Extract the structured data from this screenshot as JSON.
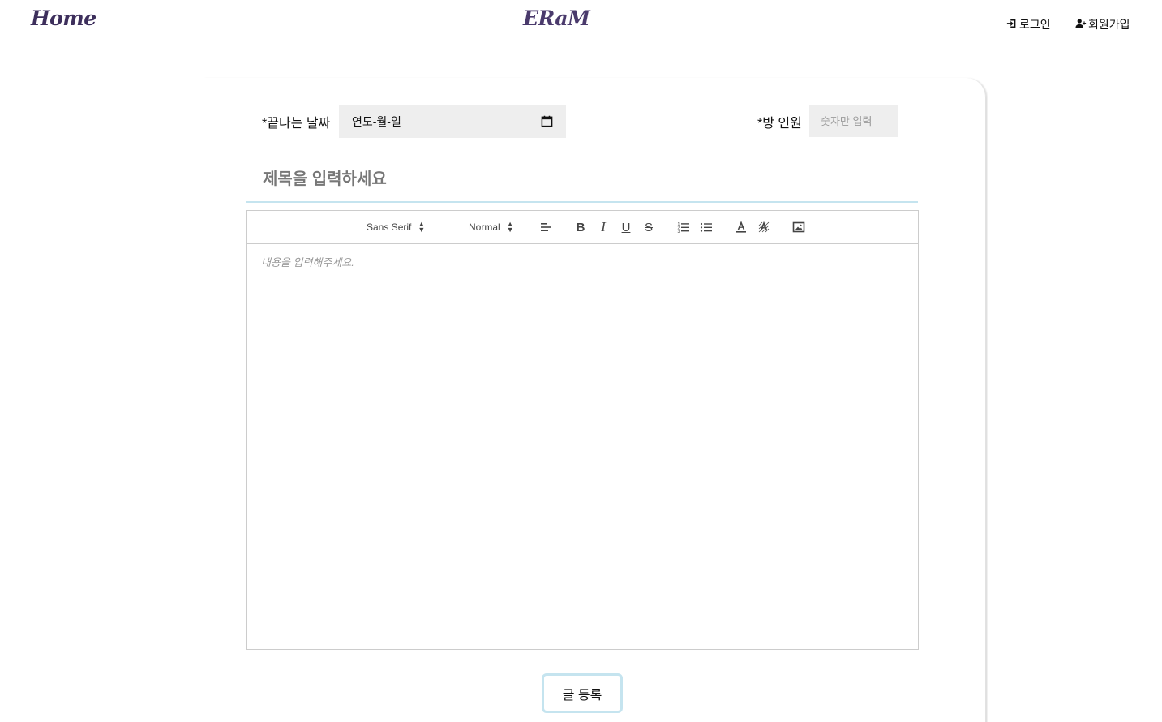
{
  "header": {
    "home_label": "Home",
    "logo_text": "ERaM",
    "login_label": "로그인",
    "signup_label": "회원가입"
  },
  "form": {
    "end_date_label": "*끝나는 날짜",
    "end_date_value": "연도-월-일",
    "room_count_label": "*방 인원",
    "room_count_placeholder": "숫자만 입력",
    "title_placeholder": "제목을 입력하세요"
  },
  "editor": {
    "font_select": "Sans Serif",
    "size_select": "Normal",
    "toolbar_icons": [
      "align-left-icon",
      "bold-icon",
      "italic-icon",
      "underline-icon",
      "strike-icon",
      "ordered-list-icon",
      "bullet-list-icon",
      "text-color-icon",
      "background-color-icon",
      "image-icon"
    ],
    "content_placeholder": "내용을 입력해주세요."
  },
  "submit_label": "글 등록",
  "colors": {
    "brand": "#3d2f5c",
    "accent_border": "#c5e4ef",
    "input_bg": "#eeeeee"
  }
}
